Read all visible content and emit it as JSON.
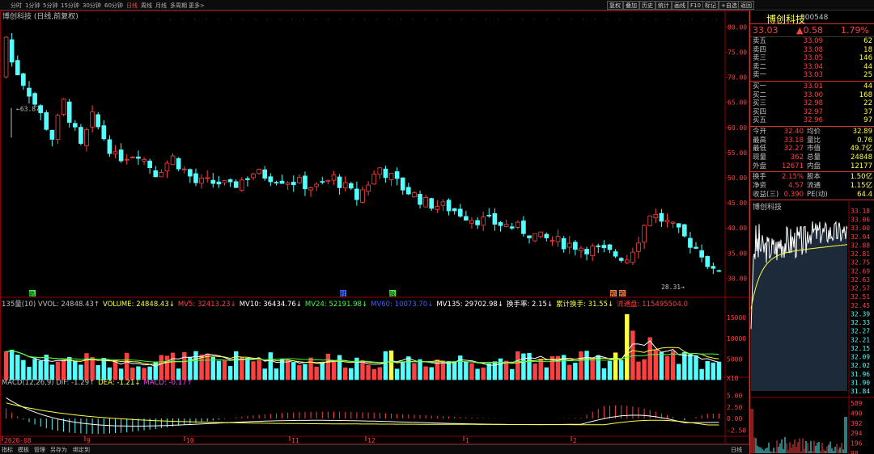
{
  "toolbar": {
    "periods": [
      "分时",
      "1分钟",
      "5分钟",
      "15分钟",
      "30分钟",
      "60分钟",
      "日线",
      "周线",
      "月线",
      "多周期",
      "更多>"
    ],
    "active_period": "日线",
    "right_buttons": [
      "复权",
      "叠加",
      "历史",
      "统计",
      "画线",
      "F10",
      "标记",
      "+自选",
      "返回"
    ]
  },
  "main_chart": {
    "title": "博创科技 (日线,前复权)",
    "high_label": "63.87",
    "low_label": "28.31",
    "price_axis": [
      "80.00",
      "75.00",
      "70.00",
      "65.00",
      "60.00",
      "55.00",
      "50.00",
      "45.00",
      "40.00",
      "35.00",
      "30.00"
    ],
    "markers": [
      "鹏",
      "时",
      "融",
      "预",
      "预"
    ]
  },
  "volume_panel": {
    "indicators": [
      {
        "text": "135量(10) VVOL: 24848.43↑",
        "color": "#c0c0c0"
      },
      {
        "text": "VOLUME: 24848.43↓",
        "color": "#ffff40"
      },
      {
        "text": "MV5: 32413.23↓",
        "color": "#ff4040"
      },
      {
        "text": "MV10: 36434.76↓",
        "color": "#ffffff"
      },
      {
        "text": "MV24: 52191.98↓",
        "color": "#40ff40"
      },
      {
        "text": "MV60: 10073.70↓",
        "color": "#4060ff"
      },
      {
        "text": "MV135: 29702.98↓",
        "color": "#ffffff"
      },
      {
        "text": "换手率: 2.15↓",
        "color": "#ffffff"
      },
      {
        "text": "累计换手: 31.55↓",
        "color": "#ffff40"
      },
      {
        "text": "流通盘: 115495504.0",
        "color": "#ff4040"
      }
    ],
    "axis": [
      "15000",
      "10000",
      "5000",
      "X10"
    ]
  },
  "macd_panel": {
    "indicators": [
      {
        "text": "MACD(12,26,9) DIF: -1.29↑",
        "color": "#c0c0c0"
      },
      {
        "text": "DEA: -1.21↓",
        "color": "#ffff40"
      },
      {
        "text": "MACD: -0.17↑",
        "color": "#ff40ff"
      }
    ],
    "axis": [
      "5.00",
      "2.50",
      "0.00",
      "-2.50"
    ]
  },
  "date_axis": [
    "2020-08",
    "9",
    "10",
    "11",
    "12",
    "1",
    "2"
  ],
  "bottom_tabs": [
    "指标",
    "模板",
    "管理",
    "另存为",
    "绑定到"
  ],
  "period_label": "日线",
  "quote": {
    "name": "博创科技",
    "code": "300548",
    "price": "33.03",
    "change": "▲0.58",
    "change_pct": "1.79%",
    "asks": [
      {
        "label": "卖五",
        "price": "33.09",
        "vol": "62"
      },
      {
        "label": "卖四",
        "price": "33.08",
        "vol": "18"
      },
      {
        "label": "卖三",
        "price": "33.05",
        "vol": "146"
      },
      {
        "label": "卖二",
        "price": "33.04",
        "vol": "44"
      },
      {
        "label": "卖一",
        "price": "33.03",
        "vol": "25"
      }
    ],
    "bids": [
      {
        "label": "买一",
        "price": "33.01",
        "vol": "44"
      },
      {
        "label": "买二",
        "price": "33.00",
        "vol": "168"
      },
      {
        "label": "买三",
        "price": "32.98",
        "vol": "22"
      },
      {
        "label": "买四",
        "price": "32.97",
        "vol": "37"
      },
      {
        "label": "买五",
        "price": "32.96",
        "vol": "97"
      }
    ],
    "stats1": [
      {
        "k1": "今开",
        "v1": "32.40",
        "k2": "均价",
        "v2": "32.89"
      },
      {
        "k1": "最高",
        "v1": "33.18",
        "k2": "量比",
        "v2": "0.76"
      },
      {
        "k1": "最低",
        "v1": "32.27",
        "k2": "市值",
        "v2": "49.7亿"
      },
      {
        "k1": "现量",
        "v1": "362",
        "k2": "总量",
        "v2": "24848"
      },
      {
        "k1": "外盘",
        "v1": "12671",
        "k2": "内盘",
        "v2": "12177"
      }
    ],
    "stats2": [
      {
        "k1": "换手",
        "v1": "2.15%",
        "k2": "股本",
        "v2": "1.50亿"
      },
      {
        "k1": "净资",
        "v1": "4.57",
        "k2": "流通",
        "v2": "1.15亿"
      },
      {
        "k1": "收益(三)",
        "v1": "0.390",
        "k2": "PE(动)",
        "v2": "64.4"
      }
    ],
    "mini_title": "博创科技",
    "mini_axis": [
      "33.18",
      "33.06",
      "33.00",
      "32.94",
      "32.88",
      "32.81",
      "32.75",
      "32.69",
      "32.63",
      "32.57",
      "32.51",
      "32.45",
      "32.39",
      "32.33",
      "32.27",
      "32.21",
      "32.15",
      "32.09",
      "32.02",
      "31.96",
      "31.90",
      "31.84"
    ],
    "mini_vol_axis": [
      "589",
      "490",
      "392",
      "294",
      "196",
      "98"
    ]
  },
  "colors": {
    "up": "#ff4040",
    "down": "#54ffff",
    "ma5": "#ffffff",
    "ma10": "#ffff40",
    "ma24": "#40ff40",
    "dif": "#ffffff",
    "dea": "#ffff40",
    "grid": "#8b0000"
  }
}
